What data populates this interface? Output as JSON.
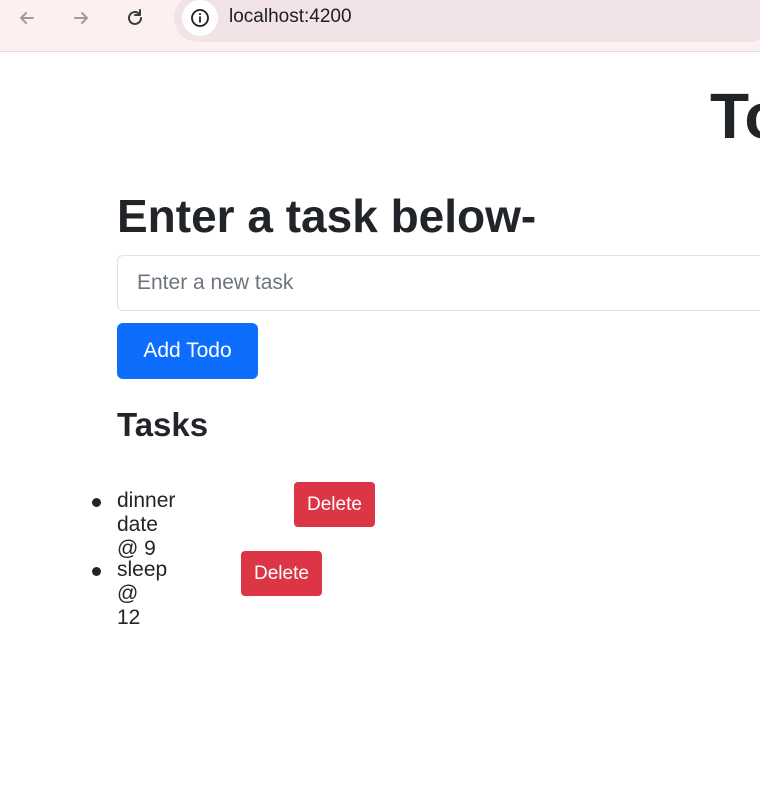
{
  "browser": {
    "url": "localhost:4200",
    "back_icon": "back-arrow-icon",
    "forward_icon": "forward-arrow-icon",
    "reload_icon": "reload-icon",
    "info_icon": "info-icon"
  },
  "page": {
    "heading": "To",
    "section_title": "Enter a task below-",
    "input": {
      "value": "",
      "placeholder": "Enter a new task"
    },
    "add_button_label": "Add Todo",
    "tasks_title": "Tasks",
    "tasks": [
      {
        "text": "dinner date @ 9",
        "delete_label": "Delete"
      },
      {
        "text": "sleep @ 12",
        "delete_label": "Delete"
      }
    ]
  },
  "colors": {
    "primary": "#0d6efd",
    "danger": "#dc3545",
    "text": "#212529",
    "browser_bar": "#fcf1f0"
  }
}
